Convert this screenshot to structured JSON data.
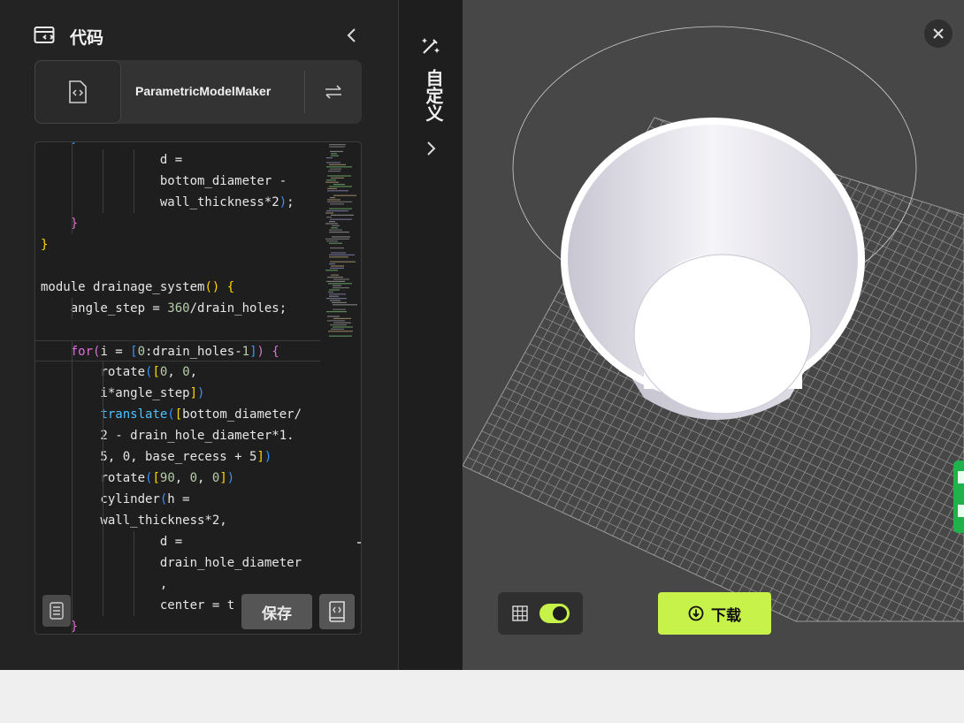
{
  "sidebar": {
    "title": "代码",
    "file_name": "ParametricModelMaker",
    "save_label": "保存"
  },
  "customize": {
    "label": "自定义"
  },
  "viewer": {
    "download_label": "下载",
    "grid_enabled": true
  },
  "icons": {
    "header": "code-window-icon",
    "collapse": "chevron-left-icon",
    "file": "code-file-icon",
    "swap": "swap-arrows-icon",
    "outline": "list-icon",
    "docs": "book-icon",
    "customize": "magic-wand-icon",
    "expand": "chevron-right-icon",
    "close": "close-icon",
    "grid": "grid-icon",
    "download": "download-icon"
  },
  "colors": {
    "accent": "#c6f24a",
    "panel_bg": "#232323",
    "viewer_bg": "#474747",
    "side_tab": "#1fb14a"
  },
  "code": [
    [
      {
        "t": "    }",
        "c": "br3"
      }
    ],
    [
      {
        "t": "                d =",
        "c": ""
      }
    ],
    [
      {
        "t": "                bottom_diameter -",
        "c": ""
      }
    ],
    [
      {
        "t": "                wall_thickness*2",
        "c": ""
      },
      {
        "t": ")",
        "c": "br3"
      },
      {
        "t": ";",
        "c": ""
      }
    ],
    [
      {
        "t": "    }",
        "c": "br2"
      }
    ],
    [
      {
        "t": "}",
        "c": "br1"
      }
    ],
    [
      {
        "t": "",
        "c": ""
      }
    ],
    [
      {
        "t": "module drainage_system",
        "c": ""
      },
      {
        "t": "()",
        "c": "br1"
      },
      {
        "t": " ",
        "c": ""
      },
      {
        "t": "{",
        "c": "br1"
      }
    ],
    [
      {
        "t": "    angle_step = ",
        "c": ""
      },
      {
        "t": "360",
        "c": "num"
      },
      {
        "t": "/drain_holes;",
        "c": ""
      }
    ],
    [
      {
        "t": "",
        "c": ""
      }
    ],
    [
      {
        "t": "    ",
        "c": ""
      },
      {
        "t": "for",
        "c": "kw"
      },
      {
        "t": "(",
        "c": "br2"
      },
      {
        "t": "i = ",
        "c": ""
      },
      {
        "t": "[",
        "c": "br3"
      },
      {
        "t": "0",
        "c": "num"
      },
      {
        "t": ":drain_holes-",
        "c": ""
      },
      {
        "t": "1",
        "c": "num"
      },
      {
        "t": "]",
        "c": "br3"
      },
      {
        "t": ")",
        "c": "br2"
      },
      {
        "t": " ",
        "c": ""
      },
      {
        "t": "{",
        "c": "br2"
      }
    ],
    [
      {
        "t": "        rotate",
        "c": ""
      },
      {
        "t": "(",
        "c": "br3"
      },
      {
        "t": "[",
        "c": "br1"
      },
      {
        "t": "0",
        "c": "num"
      },
      {
        "t": ", ",
        "c": ""
      },
      {
        "t": "0",
        "c": "num"
      },
      {
        "t": ",",
        "c": ""
      }
    ],
    [
      {
        "t": "        i*angle_step",
        "c": ""
      },
      {
        "t": "]",
        "c": "br1"
      },
      {
        "t": ")",
        "c": "br3"
      }
    ],
    [
      {
        "t": "        ",
        "c": ""
      },
      {
        "t": "translate",
        "c": "fn"
      },
      {
        "t": "(",
        "c": "br3"
      },
      {
        "t": "[",
        "c": "br1"
      },
      {
        "t": "bottom_diameter/",
        "c": ""
      }
    ],
    [
      {
        "t": "        2 - drain_hole_diameter*1.",
        "c": ""
      }
    ],
    [
      {
        "t": "        5, 0, base_recess + 5",
        "c": ""
      },
      {
        "t": "]",
        "c": "br1"
      },
      {
        "t": ")",
        "c": "br3"
      }
    ],
    [
      {
        "t": "        rotate",
        "c": ""
      },
      {
        "t": "(",
        "c": "br3"
      },
      {
        "t": "[",
        "c": "br1"
      },
      {
        "t": "90",
        "c": "num"
      },
      {
        "t": ", ",
        "c": ""
      },
      {
        "t": "0",
        "c": "num"
      },
      {
        "t": ", ",
        "c": ""
      },
      {
        "t": "0",
        "c": "num"
      },
      {
        "t": "]",
        "c": "br1"
      },
      {
        "t": ")",
        "c": "br3"
      }
    ],
    [
      {
        "t": "        cylinder",
        "c": ""
      },
      {
        "t": "(",
        "c": "br3"
      },
      {
        "t": "h =",
        "c": ""
      }
    ],
    [
      {
        "t": "        wall_thickness*2,",
        "c": ""
      }
    ],
    [
      {
        "t": "                d =",
        "c": ""
      }
    ],
    [
      {
        "t": "                drain_hole_diameter",
        "c": ""
      }
    ],
    [
      {
        "t": "                ,",
        "c": ""
      }
    ],
    [
      {
        "t": "                center = t",
        "c": ""
      }
    ],
    [
      {
        "t": "    }",
        "c": "br2"
      }
    ]
  ]
}
